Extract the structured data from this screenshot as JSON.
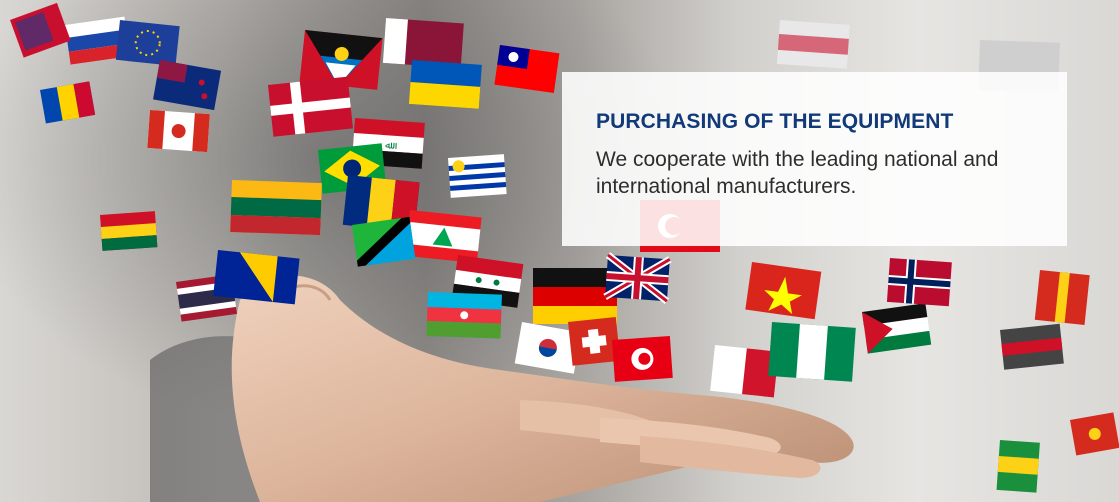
{
  "banner": {
    "title": "PURCHASING OF THE EQUIPMENT",
    "description": "We cooperate with the leading national and international manufacturers.",
    "colors": {
      "title": "#123a78",
      "text": "#2d2d2d",
      "box": "#ffffff"
    }
  },
  "flags": [
    "slovenia-flag",
    "eu-flag",
    "new-zealand-flag",
    "antigua-flag",
    "qatar-flag",
    "taiwan-flag",
    "moldova-flag",
    "canada-flag",
    "denmark-flag",
    "ukraine-flag",
    "iraq-flag",
    "brazil-flag",
    "lithuania-flag",
    "romania-flag",
    "uruguay-flag",
    "lebanon-flag",
    "tanzania-flag",
    "bosnia-flag",
    "syria-flag",
    "azerbaijan-flag",
    "germany-flag",
    "uk-flag",
    "vietnam-flag",
    "south-korea-flag",
    "switzerland-flag",
    "tunisia-flag",
    "nigeria-flag",
    "malta-flag",
    "jordan-flag",
    "thailand-flag",
    "turkey-flag",
    "norway-flag",
    "ghana-flag",
    "nepal-flag"
  ]
}
